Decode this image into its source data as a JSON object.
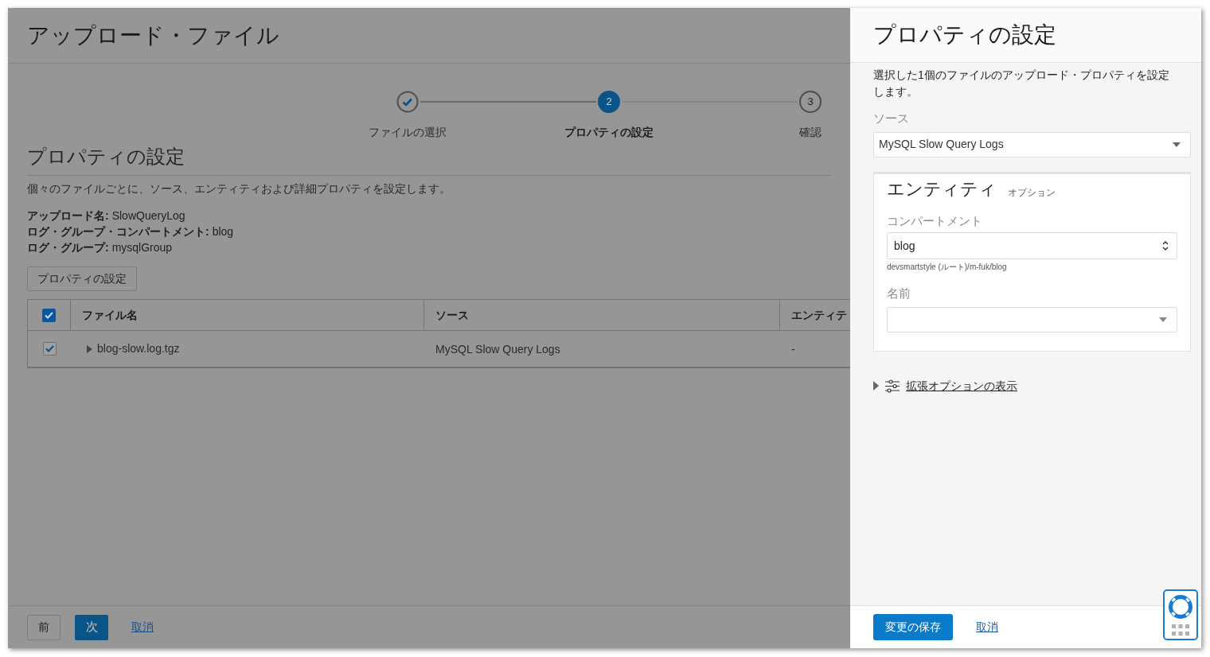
{
  "page": {
    "title": "アップロード・ファイル",
    "steps": [
      {
        "label": "ファイルの選択",
        "kind": "done",
        "selected": false
      },
      {
        "label": "プロパティの設定",
        "number": "2",
        "kind": "current",
        "selected": true
      },
      {
        "label": "確認",
        "number": "3",
        "kind": "pending",
        "selected": false
      }
    ],
    "section_title": "プロパティの設定",
    "description": "個々のファイルごとに、ソース、エンティティおよび詳細プロパティを設定します。",
    "details": [
      {
        "label": "アップロード名:",
        "value": "SlowQueryLog"
      },
      {
        "label": "ログ・グループ・コンパートメント:",
        "value": "blog"
      },
      {
        "label": "ログ・グループ:",
        "value": "mysqlGroup"
      }
    ],
    "set_properties_button": "プロパティの設定",
    "table": {
      "select_all_checked": true,
      "columns": [
        "ファイル名",
        "ソース",
        "エンティテ"
      ],
      "rows": [
        {
          "checked": true,
          "expanded": false,
          "file_name": "blog-slow.log.tgz",
          "source": "MySQL Slow Query Logs",
          "entity": "-"
        }
      ]
    },
    "footer": {
      "previous": "前",
      "next": "次",
      "cancel": "取消"
    }
  },
  "panel": {
    "title": "プロパティの設定",
    "description": "選択した1個のファイルのアップロード・プロパティを設定します。",
    "source_label": "ソース",
    "source_value": "MySQL Slow Query Logs",
    "entity": {
      "title": "エンティティ",
      "optional": "オプション",
      "compartment_label": "コンパートメント",
      "compartment_value": "blog",
      "compartment_path": "devsmartstyle (ルート)/m-fuk/blog",
      "name_label": "名前"
    },
    "advanced": {
      "expanded": false,
      "label": "拡張オプションの表示"
    },
    "save_button": "変更の保存",
    "cancel": "取消"
  }
}
